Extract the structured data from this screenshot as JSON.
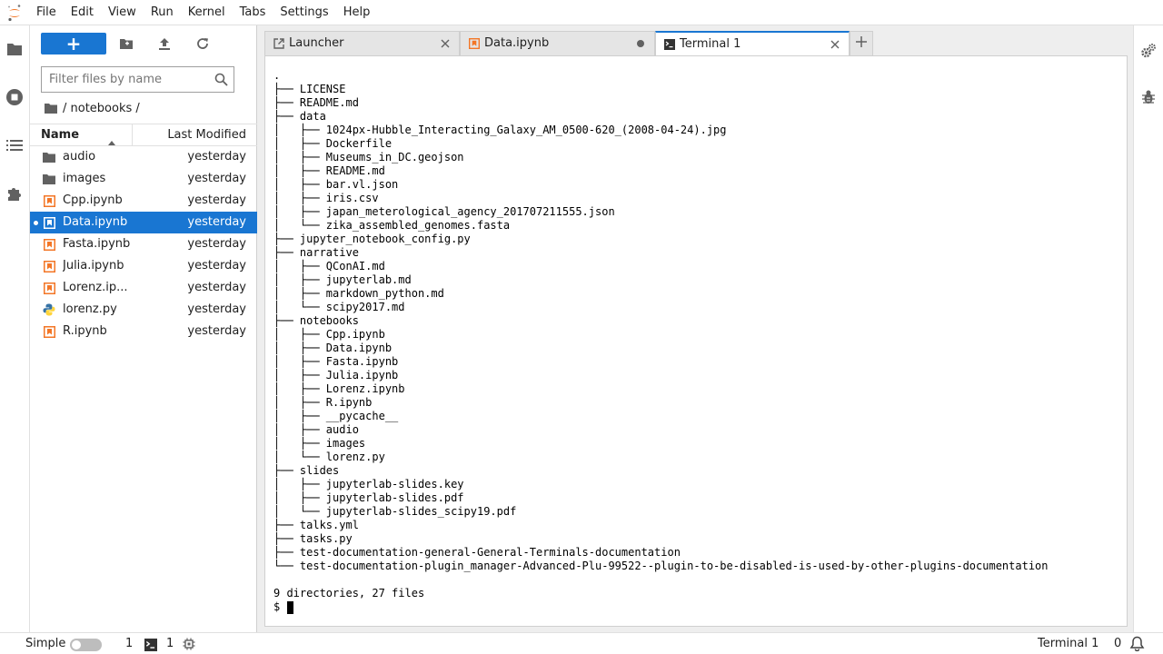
{
  "menu": {
    "items": [
      "File",
      "Edit",
      "View",
      "Run",
      "Kernel",
      "Tabs",
      "Settings",
      "Help"
    ]
  },
  "filebrowser": {
    "new_label": "+",
    "search_placeholder": "Filter files by name",
    "breadcrumb": "/ notebooks /",
    "header_name": "Name",
    "header_modified": "Last Modified",
    "files": [
      {
        "name": "audio",
        "modified": "yesterday",
        "type": "folder"
      },
      {
        "name": "images",
        "modified": "yesterday",
        "type": "folder"
      },
      {
        "name": "Cpp.ipynb",
        "modified": "yesterday",
        "type": "notebook"
      },
      {
        "name": "Data.ipynb",
        "modified": "yesterday",
        "type": "notebook"
      },
      {
        "name": "Fasta.ipynb",
        "modified": "yesterday",
        "type": "notebook"
      },
      {
        "name": "Julia.ipynb",
        "modified": "yesterday",
        "type": "notebook"
      },
      {
        "name": "Lorenz.ip...",
        "modified": "yesterday",
        "type": "notebook"
      },
      {
        "name": "lorenz.py",
        "modified": "yesterday",
        "type": "python"
      },
      {
        "name": "R.ipynb",
        "modified": "yesterday",
        "type": "notebook"
      }
    ]
  },
  "tabs": [
    {
      "label": "Launcher"
    },
    {
      "label": "Data.ipynb"
    },
    {
      "label": "Terminal 1"
    }
  ],
  "terminal": {
    "lines": [
      ".",
      "├── LICENSE",
      "├── README.md",
      "├── data",
      "│   ├── 1024px-Hubble_Interacting_Galaxy_AM_0500-620_(2008-04-24).jpg",
      "│   ├── Dockerfile",
      "│   ├── Museums_in_DC.geojson",
      "│   ├── README.md",
      "│   ├── bar.vl.json",
      "│   ├── iris.csv",
      "│   ├── japan_meterological_agency_201707211555.json",
      "│   └── zika_assembled_genomes.fasta",
      "├── jupyter_notebook_config.py",
      "├── narrative",
      "│   ├── QConAI.md",
      "│   ├── jupyterlab.md",
      "│   ├── markdown_python.md",
      "│   └── scipy2017.md",
      "├── notebooks",
      "│   ├── Cpp.ipynb",
      "│   ├── Data.ipynb",
      "│   ├── Fasta.ipynb",
      "│   ├── Julia.ipynb",
      "│   ├── Lorenz.ipynb",
      "│   ├── R.ipynb",
      "│   ├── __pycache__",
      "│   ├── audio",
      "│   ├── images",
      "│   └── lorenz.py",
      "├── slides",
      "│   ├── jupyterlab-slides.key",
      "│   ├── jupyterlab-slides.pdf",
      "│   └── jupyterlab-slides_scipy19.pdf",
      "├── talks.yml",
      "├── tasks.py",
      "├── test-documentation-general-General-Terminals-documentation",
      "└── test-documentation-plugin_manager-Advanced-Plu-99522--plugin-to-be-disabled-is-used-by-other-plugins-documentation",
      "",
      "9 directories, 27 files"
    ],
    "prompt": "$ "
  },
  "statusbar": {
    "simple_label": "Simple",
    "kernels_count": "1",
    "terminals_count": "1",
    "active_label": "Terminal 1",
    "notifications_count": "0"
  },
  "colors": {
    "accent": "#1976d2",
    "notebook_icon": "#f37626"
  }
}
